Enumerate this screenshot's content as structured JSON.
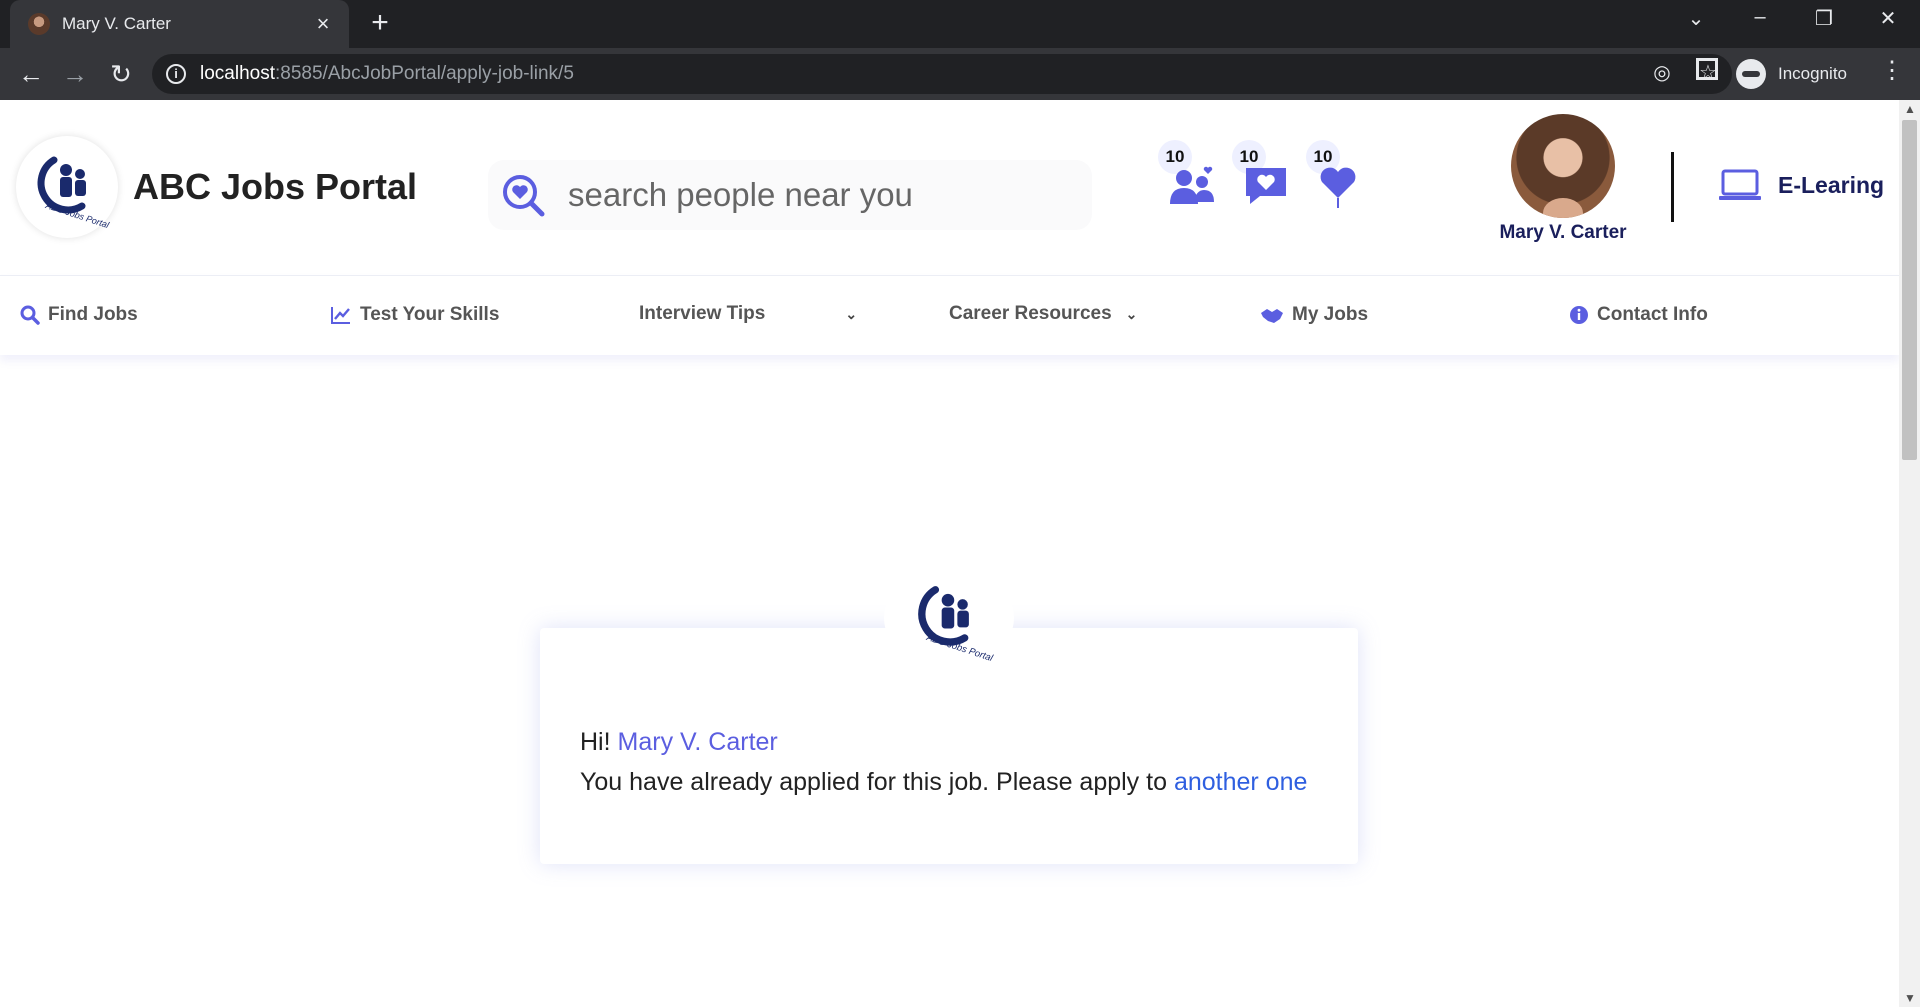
{
  "browser": {
    "tab_title": "Mary V. Carter",
    "url_host": "localhost",
    "url_rest": ":8585/AbcJobPortal/apply-job-link/5",
    "incognito_label": "Incognito"
  },
  "header": {
    "brand": "ABC Jobs Portal",
    "search_placeholder": "search people near you",
    "notifications": [
      {
        "icon": "people-icon",
        "count": "10"
      },
      {
        "icon": "chat-heart-icon",
        "count": "10"
      },
      {
        "icon": "heart-icon",
        "count": "10"
      }
    ],
    "user_name": "Mary V. Carter",
    "elearning_label": "E-Learing"
  },
  "nav": {
    "items": [
      {
        "label": "Find Jobs",
        "icon": "search-icon"
      },
      {
        "label": "Test Your Skills",
        "icon": "chart-line-icon"
      },
      {
        "label": "Interview Tips",
        "icon": "chevron-down-icon"
      },
      {
        "label": "Career Resources",
        "icon": "chevron-down-icon"
      },
      {
        "label": "My Jobs",
        "icon": "handshake-icon"
      },
      {
        "label": "Contact Info",
        "icon": "info-icon"
      }
    ]
  },
  "message": {
    "greeting": "Hi!",
    "name": "Mary V. Carter",
    "text": "You have already applied for this job. Please apply to",
    "link": "another one"
  },
  "colors": {
    "accent": "#5b5ee0",
    "navy": "#1a1f5c",
    "link": "#2f5fe0"
  }
}
